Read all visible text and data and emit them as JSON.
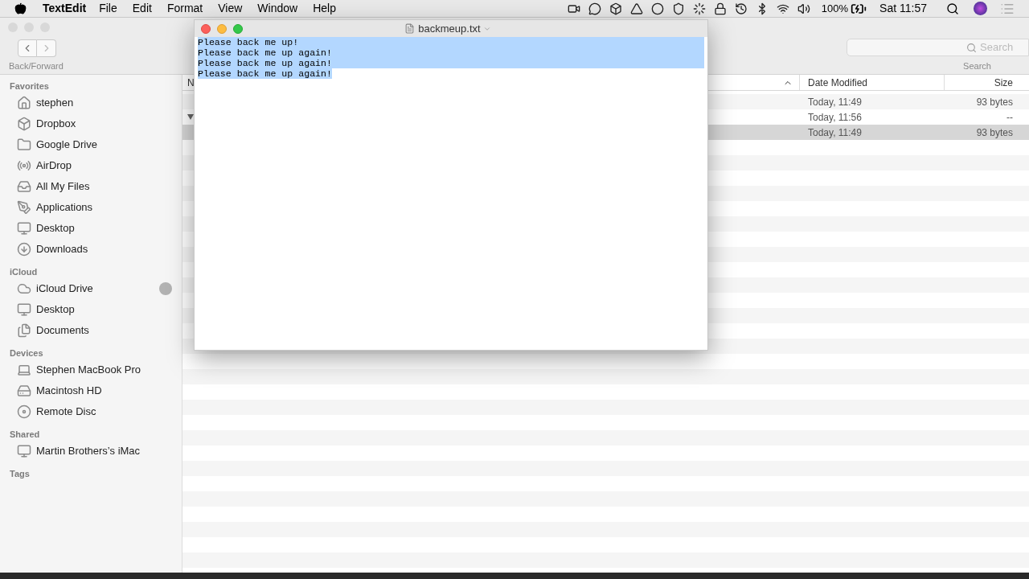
{
  "menu_bar": {
    "app": "TextEdit",
    "menus": [
      "File",
      "Edit",
      "Format",
      "View",
      "Window",
      "Help"
    ],
    "battery": "100%",
    "clock": "Sat 11:57"
  },
  "finder": {
    "nav_label": "Back/Forward",
    "search": {
      "placeholder": "Search"
    },
    "search_label": "Search",
    "sidebar": [
      {
        "title": "Favorites",
        "items": [
          {
            "label": "stephen",
            "syncing": false
          },
          {
            "label": "Dropbox",
            "syncing": false
          },
          {
            "label": "Google Drive",
            "syncing": false
          },
          {
            "label": "AirDrop",
            "syncing": false
          },
          {
            "label": "All My Files",
            "syncing": false
          },
          {
            "label": "Applications",
            "syncing": false
          },
          {
            "label": "Desktop",
            "syncing": false
          },
          {
            "label": "Downloads",
            "syncing": false
          }
        ]
      },
      {
        "title": "iCloud",
        "items": [
          {
            "label": "iCloud Drive",
            "syncing": true
          },
          {
            "label": "Desktop",
            "syncing": false
          },
          {
            "label": "Documents",
            "syncing": false
          }
        ]
      },
      {
        "title": "Devices",
        "items": [
          {
            "label": "Stephen MacBook Pro",
            "syncing": false
          },
          {
            "label": "Macintosh HD",
            "syncing": false
          },
          {
            "label": "Remote Disc",
            "syncing": false
          }
        ]
      },
      {
        "title": "Shared",
        "items": [
          {
            "label": "Martin Brothers’s iMac",
            "syncing": false
          }
        ]
      },
      {
        "title": "Tags"
      }
    ],
    "table": {
      "columns": [
        "N",
        "Date Modified",
        "Size"
      ],
      "rows": [
        {
          "kind": "file",
          "selected": false,
          "date": "Today, 11:49",
          "size": "93 bytes"
        },
        {
          "kind": "folder",
          "expanded": true,
          "selected": false,
          "date": "Today, 11:56",
          "size": "--"
        },
        {
          "kind": "file",
          "selected": true,
          "date": "Today, 11:49",
          "size": "93 bytes"
        }
      ]
    }
  },
  "editor": {
    "title": "backmeup.txt",
    "lines": [
      {
        "text": "Please back me up!",
        "selected": true
      },
      {
        "text": "Please back me up again!",
        "selected": true
      },
      {
        "text": "Please back me up again!",
        "selected": true
      },
      {
        "text": "Please back me up again!",
        "selected": true
      }
    ]
  }
}
